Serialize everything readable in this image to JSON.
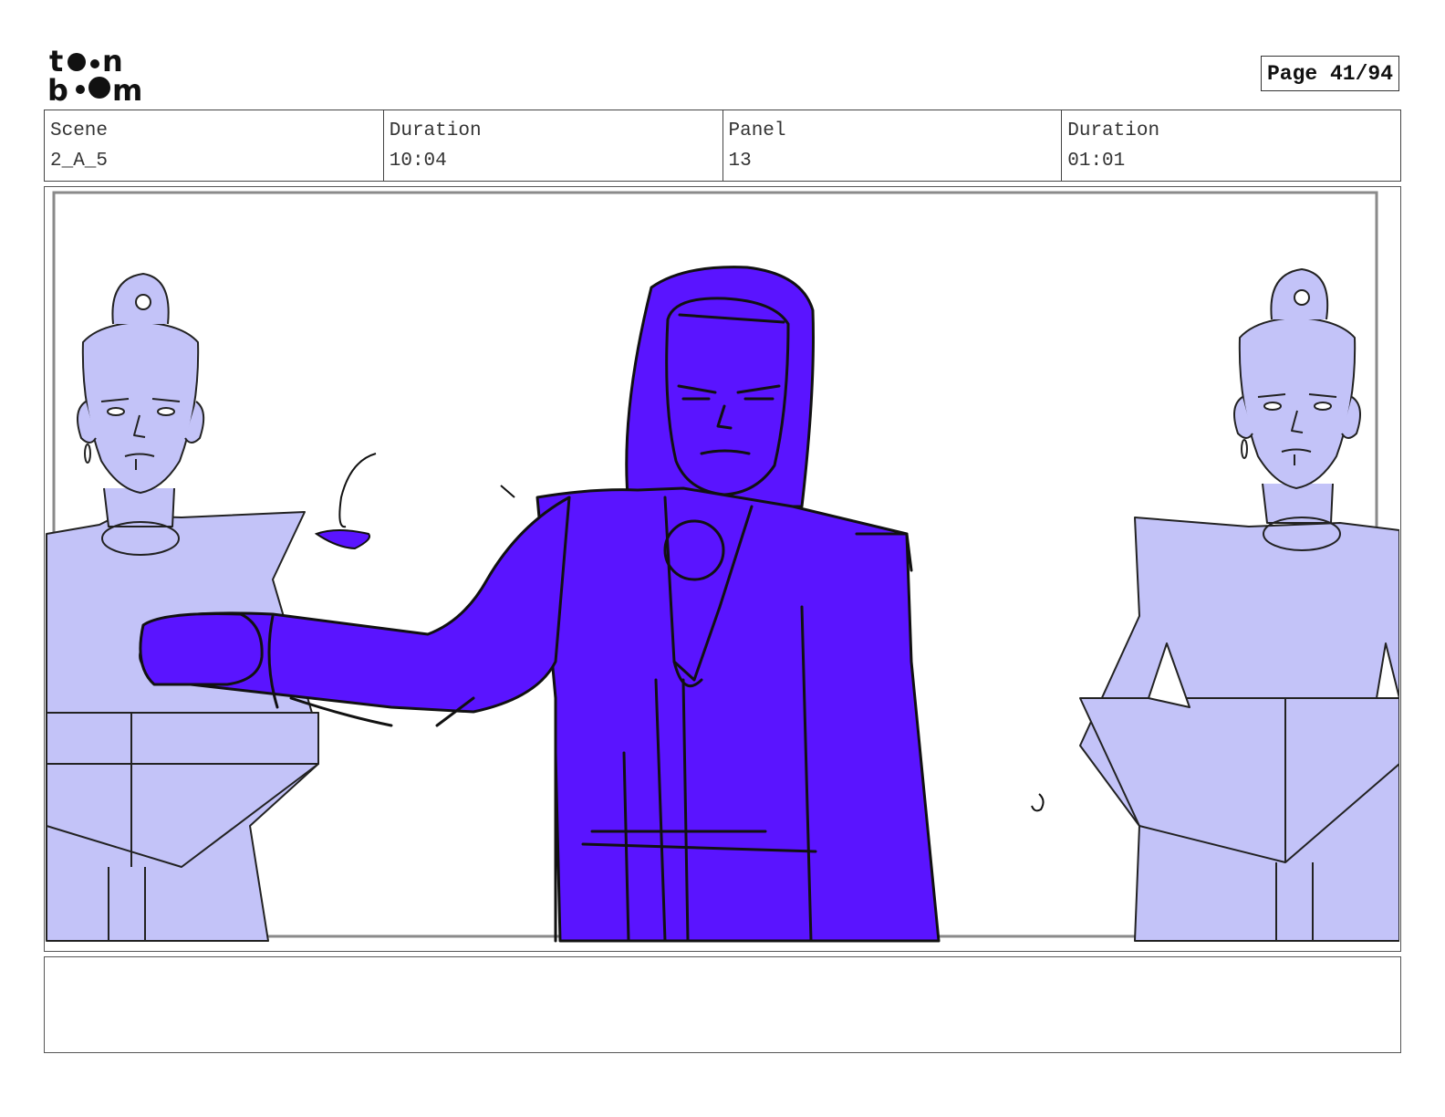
{
  "header": {
    "logo_line1": "toon",
    "logo_line2": "boom",
    "page_label": "Page 41/94"
  },
  "info": {
    "scene_label": "Scene",
    "scene_value": "2_A_5",
    "duration_label": "Duration",
    "duration_value": "10:04",
    "panel_label": "Panel",
    "panel_value": "13",
    "panel_duration_label": "Duration",
    "panel_duration_value": "01:01"
  },
  "panel": {
    "main_character_color": "#5a14ff",
    "side_character_color": "#c3c3f8",
    "frame_color": "#8a8a8a"
  },
  "notes": {
    "text": ""
  }
}
